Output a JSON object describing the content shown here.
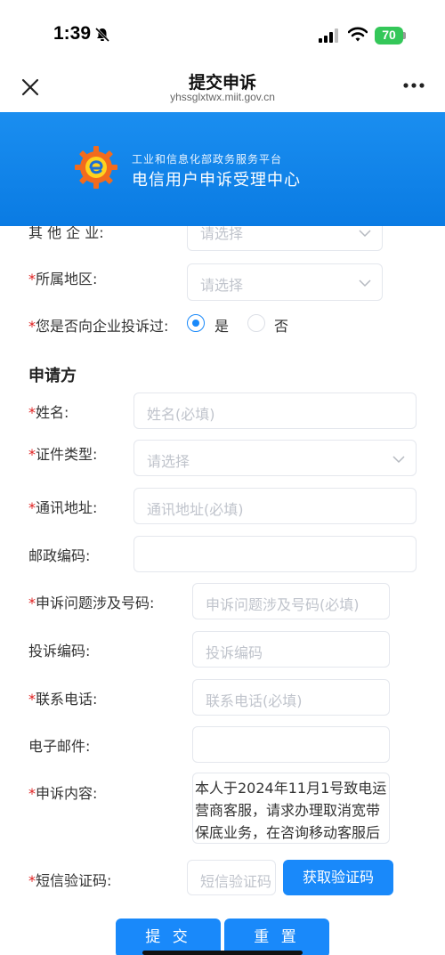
{
  "status_bar": {
    "time": "1:39",
    "battery": "70"
  },
  "nav": {
    "title": "提交申诉",
    "subtitle": "yhssglxtwx.miit.gov.cn"
  },
  "banner": {
    "subtitle": "工业和信息化部政务服务平台",
    "title": "电信用户申诉受理中心"
  },
  "form": {
    "other_company": {
      "label": "其 他 企 业:",
      "placeholder": "请选择"
    },
    "region": {
      "required": "*",
      "label": "所属地区:",
      "placeholder": "请选择"
    },
    "complained_before": {
      "required": "*",
      "label": "您是否向企业投诉过:",
      "options": [
        {
          "label": "是",
          "selected": true
        },
        {
          "label": "否",
          "selected": false
        }
      ]
    }
  },
  "applicant": {
    "section_title": "申请方",
    "name": {
      "required": "*",
      "label": "姓名:",
      "placeholder": "姓名(必填)"
    },
    "id_type": {
      "required": "*",
      "label": "证件类型:",
      "placeholder": "请选择"
    },
    "address": {
      "required": "*",
      "label": "通讯地址:",
      "placeholder": "通讯地址(必填)"
    },
    "postcode": {
      "label": "邮政编码:",
      "value": ""
    },
    "phone_number": {
      "required": "*",
      "label": "申诉问题涉及号码:",
      "placeholder": "申诉问题涉及号码(必填)"
    },
    "complaint_code": {
      "label": "投诉编码:",
      "placeholder": "投诉编码"
    },
    "contact_phone": {
      "required": "*",
      "label": "联系电话:",
      "placeholder": "联系电话(必填)"
    },
    "email": {
      "label": "电子邮件:",
      "value": ""
    },
    "content": {
      "required": "*",
      "label": "申诉内容:",
      "value": "本人于2024年11月1号致电运营商客服，请求办理取消宽带保底业务，在咨询移动客服后"
    },
    "sms_code": {
      "required": "*",
      "label": "短信验证码:",
      "placeholder": "短信验证码",
      "button": "获取验证码"
    }
  },
  "actions": {
    "submit": "提 交",
    "reset": "重 置"
  },
  "colors": {
    "primary": "#1989fa",
    "required": "#e02020",
    "banner": "#0a7be3"
  }
}
